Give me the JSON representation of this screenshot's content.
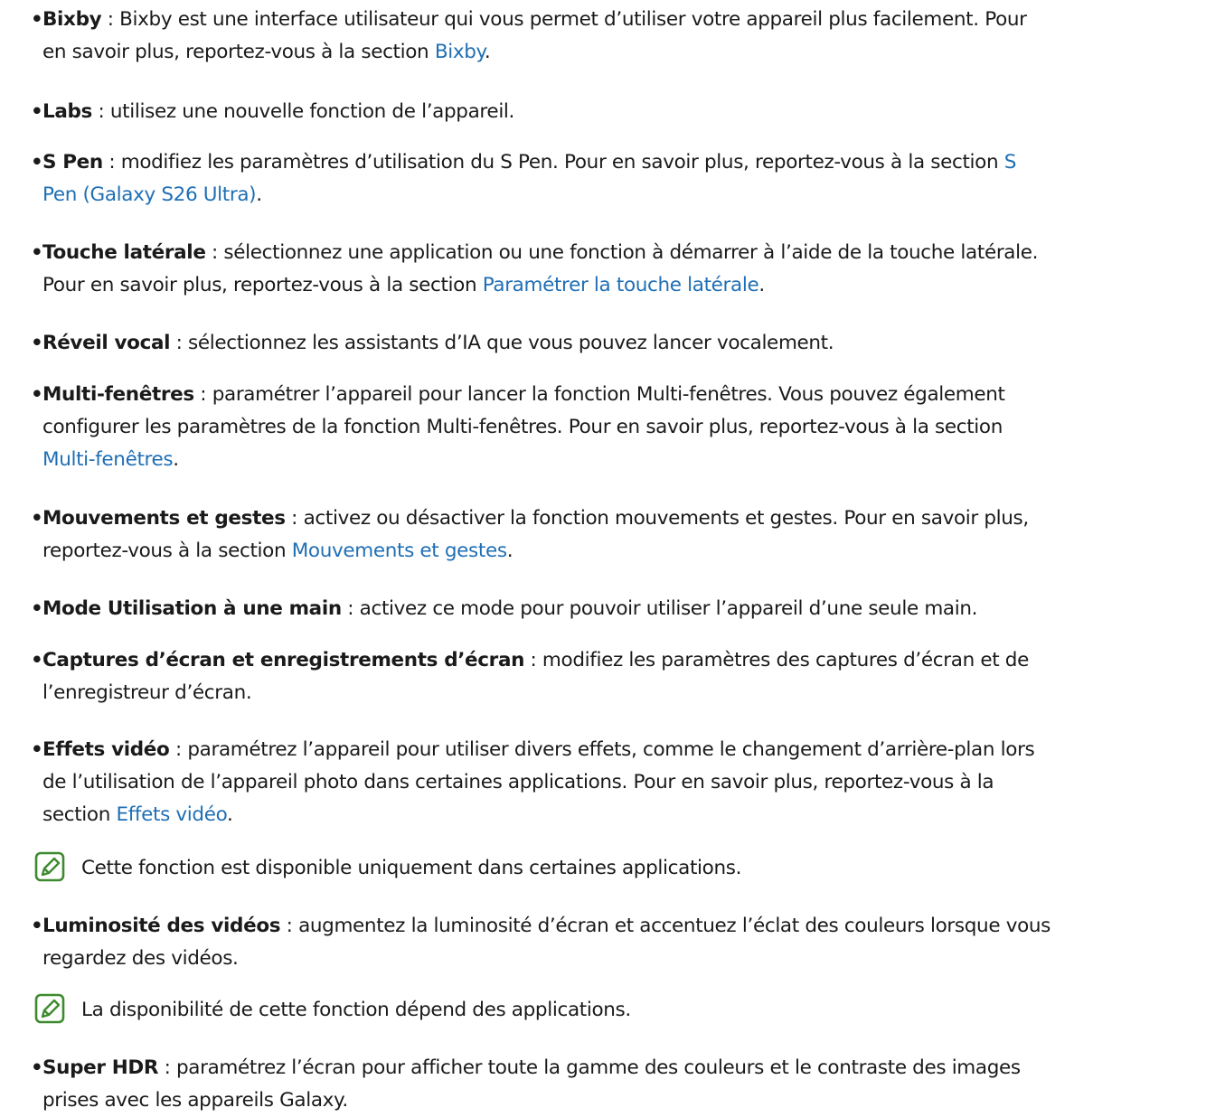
{
  "accent_color": "#1f6fb5",
  "note_icon_color": "#3e8a2e",
  "items": [
    {
      "term": "Bixby",
      "line1_text": " : Bixby est une interface utilisateur qui vous permet d’utiliser votre appareil plus facilement. Pour",
      "line2_text": "en savoir plus, reportez-vous à la section ",
      "line2_link": "Bixby",
      "line2_after": "."
    },
    {
      "term": "Labs",
      "line1_text": " : utilisez une nouvelle fonction de l’appareil."
    },
    {
      "term": "S Pen",
      "line1_text": " : modifiez les paramètres d’utilisation du S Pen. Pour en savoir plus, reportez-vous à la section ",
      "line1_link": "S",
      "line2_link": "Pen (Galaxy S26 Ultra)",
      "line2_after": "."
    },
    {
      "term": "Touche latérale",
      "line1_text": " : sélectionnez une application ou une fonction à démarrer à l’aide de la touche latérale.",
      "line2_text": "Pour en savoir plus, reportez-vous à la section ",
      "line2_link": "Paramétrer la touche latérale",
      "line2_after": "."
    },
    {
      "term": "Réveil vocal",
      "line1_text": " : sélectionnez les assistants d’IA que vous pouvez lancer vocalement."
    },
    {
      "term": "Multi-fenêtres",
      "line1_text": " : paramétrer l’appareil pour lancer la fonction Multi-fenêtres. Vous pouvez également",
      "line2_text": "configurer les paramètres de la fonction Multi-fenêtres. Pour en savoir plus, reportez-vous à la section",
      "line3_link": "Multi-fenêtres",
      "line3_after": "."
    },
    {
      "term": "Mouvements et gestes",
      "line1_text": " : activez ou désactiver la fonction mouvements et gestes. Pour en savoir plus,",
      "line2_text": "reportez-vous à la section ",
      "line2_link": "Mouvements et gestes",
      "line2_after": "."
    },
    {
      "term": "Mode Utilisation à une main",
      "line1_text": " : activez ce mode pour pouvoir utiliser l’appareil d’une seule main."
    },
    {
      "term": "Captures d’écran et enregistrements d’écran",
      "line1_text": " : modifiez les paramètres des captures d’écran et de",
      "line2_text": "l’enregistreur d’écran."
    },
    {
      "term": "Effets vidéo",
      "line1_text": " : paramétrez l’appareil pour utiliser divers effets, comme le changement d’arrière-plan lors",
      "line2_text": "de l’utilisation de l’appareil photo dans certaines applications. Pour en savoir plus, reportez-vous à la",
      "line3_text": "section ",
      "line3_link": "Effets vidéo",
      "line3_after": "."
    },
    {
      "term": "Luminosité des vidéos",
      "line1_text": " : augmentez la luminosité d’écran et accentuez l’éclat des couleurs lorsque vous",
      "line2_text": "regardez des vidéos."
    },
    {
      "term": "Super HDR",
      "line1_text": " : paramétrez l’écran pour afficher toute la gamme des couleurs et le contraste des images",
      "line2_text": "prises avec les appareils Galaxy."
    }
  ],
  "notes": [
    {
      "icon": "note-pencil-icon",
      "text": "Cette fonction est disponible uniquement dans certaines applications."
    },
    {
      "icon": "note-pencil-icon",
      "text": "La disponibilité de cette fonction dépend des applications."
    }
  ]
}
